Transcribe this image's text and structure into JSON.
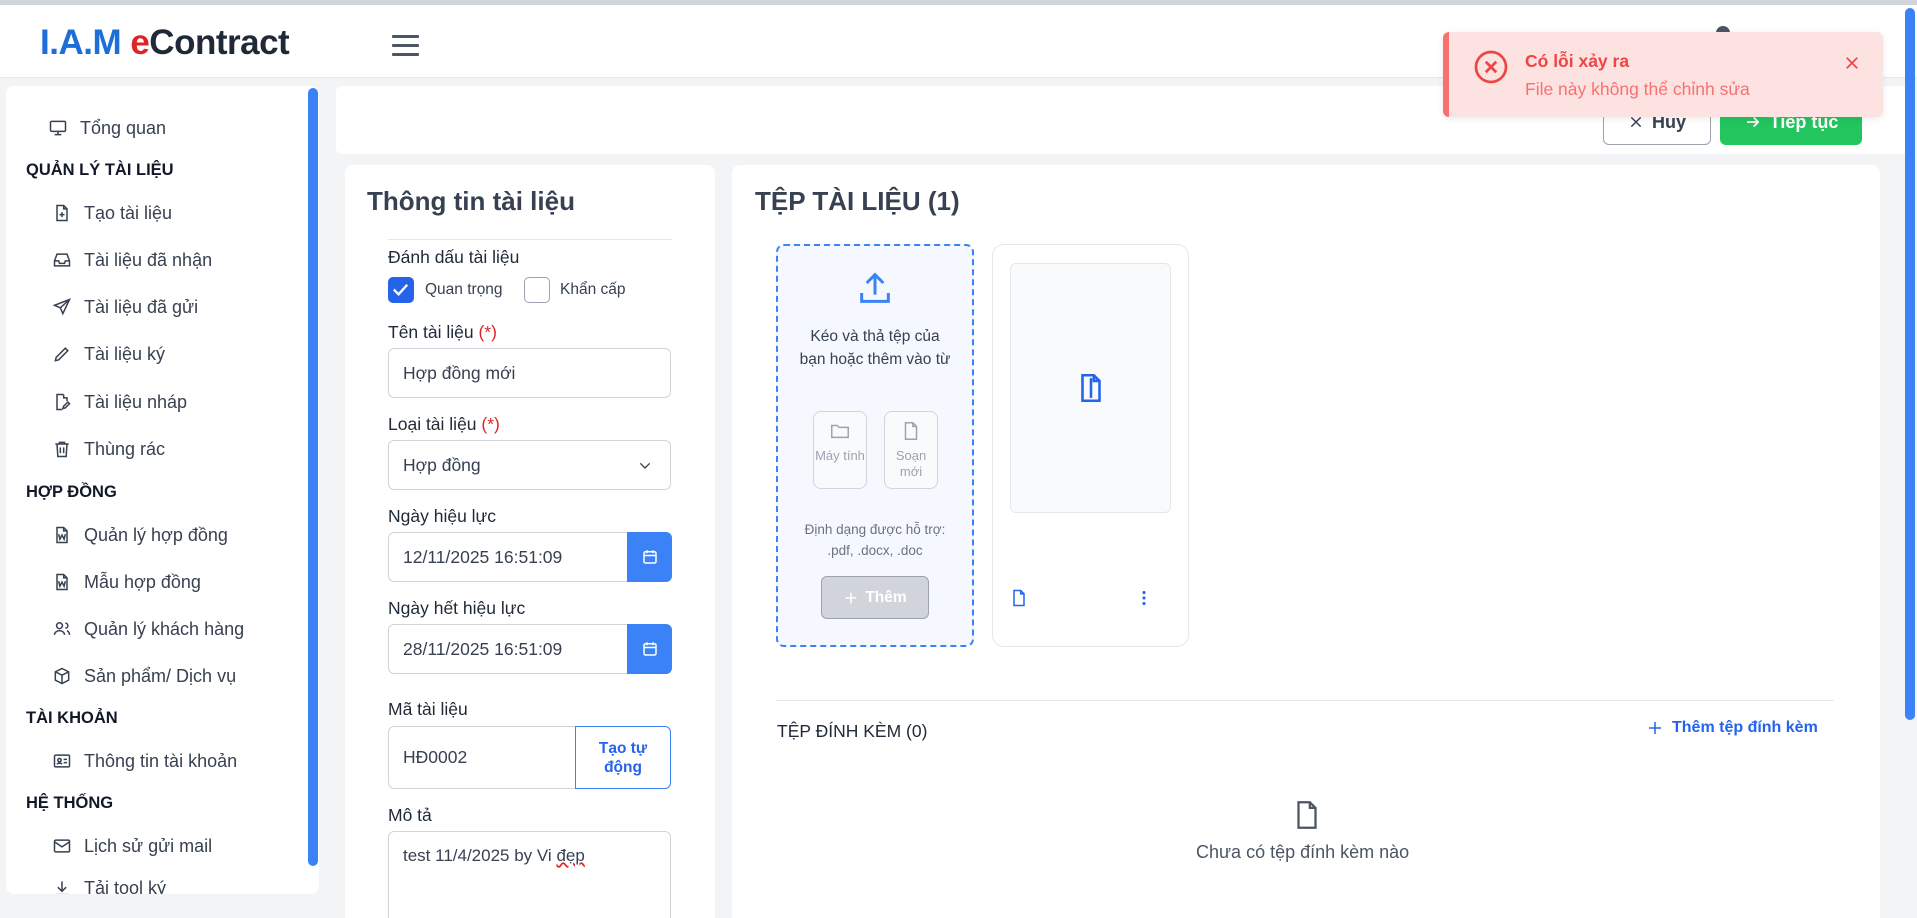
{
  "header": {
    "logo_iam": "I.A.M ",
    "logo_e": "e",
    "logo_rest": "Contract"
  },
  "sidebar": {
    "overview": "Tổng quan",
    "sections": [
      {
        "title": "QUẢN LÝ TÀI LIỆU",
        "items": [
          "Tạo tài liệu",
          "Tài liệu đã nhận",
          "Tài liệu đã gửi",
          "Tài liệu ký",
          "Tài liệu nháp",
          "Thùng rác"
        ]
      },
      {
        "title": "HỢP ĐỒNG",
        "items": [
          "Quản lý hợp đồng",
          "Mẫu hợp đồng",
          "Quản lý khách hàng",
          "Sản phẩm/ Dịch vụ"
        ]
      },
      {
        "title": "TÀI KHOẢN",
        "items": [
          "Thông tin tài khoản"
        ]
      },
      {
        "title": "HỆ THỐNG",
        "items": [
          "Lịch sử gửi mail",
          "Tải tool ký"
        ]
      }
    ]
  },
  "toolbar": {
    "cancel_label": "Hủy",
    "next_label": "Tiếp tục"
  },
  "doc_info": {
    "title": "Thông tin tài liệu",
    "mark_label": "Đánh dấu tài liệu",
    "important_label": "Quan trọng",
    "important_checked": true,
    "urgent_label": "Khẩn cấp",
    "urgent_checked": false,
    "required_mark": "(*)",
    "name_label": "Tên tài liệu",
    "name_value": "Hợp đồng mới",
    "type_label": "Loại tài liệu",
    "type_value": "Hợp đồng",
    "effective_label": "Ngày hiệu lực",
    "effective_value": "12/11/2025 16:51:09",
    "expiry_label": "Ngày hết hiệu lực",
    "expiry_value": "28/11/2025 16:51:09",
    "code_label": "Mã tài liệu",
    "code_value": "HĐ0002",
    "auto_label_1": "Tạo tự",
    "auto_label_2": "động",
    "desc_label": "Mô tả",
    "desc_value_pre": "test 11/4/2025 by Vi ",
    "desc_value_misspelled": "đẹp"
  },
  "files": {
    "title": "TỆP TÀI LIỆU (1)",
    "drop_text": "Kéo và thả tệp của bạn hoặc thêm vào từ",
    "source_computer": "Máy tính",
    "source_new": "Soạn mới",
    "formats_note": "Định dạng được hỗ trợ: .pdf, .docx, .doc",
    "add_label": "Thêm",
    "attachments_title": "TỆP ĐÍNH KÈM (0)",
    "add_attachment_label": "Thêm tệp đính kèm",
    "no_attachments": "Chưa có tệp đính kèm nào"
  },
  "toast": {
    "title": "Có lỗi xảy ra",
    "message": "File này không thể chỉnh sửa"
  },
  "colors": {
    "primary": "#3b82f6",
    "success": "#22c55e",
    "danger": "#ef4444",
    "toast_bg": "#fde2e2"
  }
}
